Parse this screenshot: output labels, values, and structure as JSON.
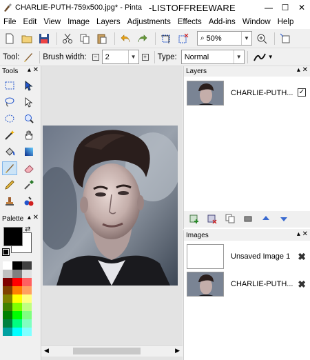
{
  "window": {
    "title": "CHARLIE-PUTH-759x500.jpg* - Pinta",
    "watermark": "-LISTOFFREEWARE",
    "controls": {
      "minimize": "—",
      "maximize": "☐",
      "close": "✕"
    }
  },
  "menu": [
    "File",
    "Edit",
    "View",
    "Image",
    "Layers",
    "Adjustments",
    "Effects",
    "Add-ins",
    "Window",
    "Help"
  ],
  "toolbar": {
    "zoom_value": "50%"
  },
  "tool_options": {
    "tool_label": "Tool:",
    "brush_width_label": "Brush width:",
    "brush_width_value": "2",
    "type_label": "Type:",
    "type_value": "Normal"
  },
  "tools_panel": {
    "title": "Tools",
    "pin": "▴ ✕"
  },
  "palette_panel": {
    "title": "Palette",
    "pin": "▴ ✕"
  },
  "layers_panel": {
    "title": "Layers",
    "pin": "▴ ✕",
    "layers": [
      {
        "name": "CHARLIE-PUTH...",
        "visible": true
      }
    ]
  },
  "images_panel": {
    "title": "Images",
    "pin": "▴ ✕",
    "images": [
      {
        "name": "Unsaved Image 1"
      },
      {
        "name": "CHARLIE-PUTH..."
      }
    ]
  },
  "colors": {
    "primary": "#000000",
    "secondary": "#ffffff",
    "selection": "#cce4f7"
  }
}
